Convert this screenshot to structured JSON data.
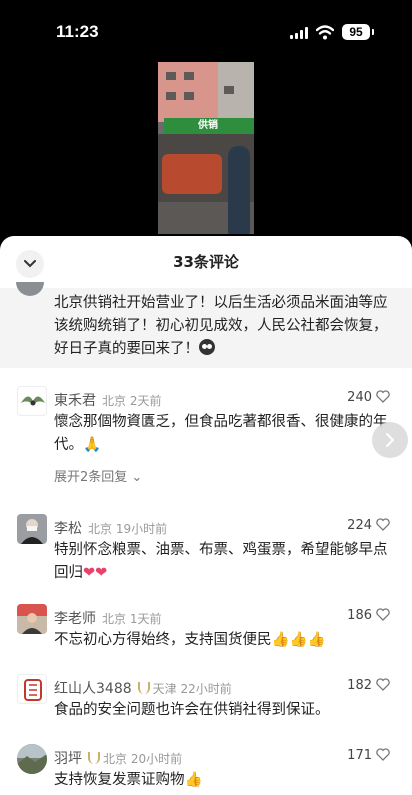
{
  "status_bar": {
    "time": "11:23",
    "battery": "95"
  },
  "video": {
    "sign_text": "供销"
  },
  "header": {
    "title": "33条评论"
  },
  "pinned_comment": {
    "text": "北京供销社开始营业了！以后生活必须品米面油等应该统购统销了！初心初见成效，人民公社都会恢复，好日子真的要回来了！"
  },
  "comments": [
    {
      "name": "東禾君",
      "meta": "北京 2天前",
      "likes": "240",
      "text": "懷念那個物資匱乏，但食品吃著都很香、很健康的年代。",
      "emoji": "🙏",
      "replies": "展开2条回复 ⌄"
    },
    {
      "name": "李松",
      "meta": "北京 19小时前",
      "likes": "224",
      "text": "特别怀念粮票、油票、布票、鸡蛋票，希望能够早点回归",
      "emoji": "❤❤"
    },
    {
      "name": "李老师",
      "meta": "北京 1天前",
      "likes": "186",
      "text": "不忘初心方得始终，支持国货便民",
      "emoji": "👍👍👍"
    },
    {
      "name": "红山人3488",
      "meta": "天津 22小时前",
      "likes": "182",
      "text": "食品的安全问题也许会在供销社得到保证。"
    },
    {
      "name": "羽坪",
      "meta": "北京 20小时前",
      "likes": "171",
      "text": "支持恢复发票证购物",
      "emoji": "👍"
    }
  ]
}
